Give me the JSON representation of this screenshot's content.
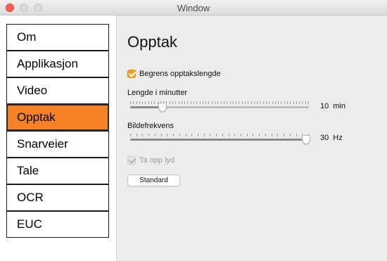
{
  "window": {
    "title": "Window"
  },
  "sidebar": {
    "items": [
      {
        "label": "Om"
      },
      {
        "label": "Applikasjon"
      },
      {
        "label": "Video"
      },
      {
        "label": "Opptak",
        "selected": true
      },
      {
        "label": "Snarveier"
      },
      {
        "label": "Tale"
      },
      {
        "label": "OCR"
      },
      {
        "label": "EUC"
      }
    ]
  },
  "content": {
    "title": "Opptak",
    "limit_checkbox": {
      "label": "Begrens opptakslengde",
      "checked": true
    },
    "length": {
      "label": "Lengde i minutter",
      "value": "10",
      "unit": "min",
      "slider_fraction": 0.17
    },
    "framerate": {
      "label": "Bildefrekvens",
      "value": "30",
      "unit": "Hz",
      "slider_fraction": 1.0
    },
    "audio_checkbox": {
      "label": "Ta opp lyd",
      "checked": true,
      "enabled": false
    },
    "standard_button": {
      "label": "Standard"
    }
  },
  "colors": {
    "accent": "#f58224",
    "checkbox": "#f5a020",
    "close": "#fd5f57"
  }
}
